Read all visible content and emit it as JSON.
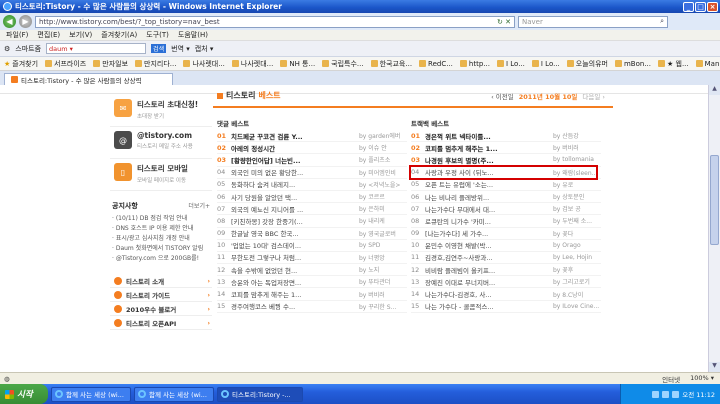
{
  "window": {
    "title": "티스토리:Tistory - 수 많은 사람들의 상상력 - Windows Internet Explorer",
    "min": "_",
    "max": "□",
    "close": "×"
  },
  "address": {
    "url": "http://www.tistory.com/best/?_top_tistory=nav_best",
    "search_placeholder": "Naver"
  },
  "menu": [
    "파일(F)",
    "편집(E)",
    "보기(V)",
    "즐겨찾기(A)",
    "도구(T)",
    "도움말(H)"
  ],
  "toolbar": {
    "brand": "스마트줌",
    "input_value": "daum ▾",
    "search_btn": "검색",
    "translate": "번역 ▾",
    "capture": "캡처 ▾"
  },
  "favorites": {
    "label": "즐겨찾기",
    "items": [
      "서프라이즈",
      "만자일보",
      "만지리다...",
      "나사렛대...",
      "나사렛대...",
      "NH 통...",
      "국립특수...",
      "한국교육...",
      "RedC...",
      "http...",
      "I Lo...",
      "I Lo...",
      "오늘의유머",
      "mBon...",
      "★ 웹...",
      "Mani..."
    ]
  },
  "tab": {
    "label": "티스토리:Tistory - 수 많은 사람들의 상상력"
  },
  "sidebar": {
    "items": [
      {
        "title": "티스토리 초대신청!",
        "sub": "초대장 받기"
      },
      {
        "title": "@tistory.com",
        "sub": "티스토리 메일 주소 사용"
      },
      {
        "title": "티스토리 모바일",
        "sub": "모바일 페이지로 이동"
      }
    ],
    "notice": {
      "title": "공지사항",
      "more": "더보기+",
      "items": [
        "(10/11) DB 점검 작업 안내",
        "DNS 호스트 IP 이용 제한 안내",
        "표시/광고 심사지침 개정 안내",
        "Daum 첫화면에서 TISTORY 알림",
        "@Tistory.com 으로 200GB를!"
      ]
    },
    "links": [
      "티스토리 소개",
      "티스토리 가이드",
      "2010우수 블로거",
      "티스토리 오픈API"
    ]
  },
  "main": {
    "title_prefix": "티스토리",
    "title_accent": "베스트",
    "prev": "‹ 이전일",
    "date": "2011년 10월 10일",
    "next": "다음일 ›",
    "left_col": {
      "heading": "댓글 베스트",
      "rows": [
        {
          "rank": "01",
          "title": "치드페균 꾸코견 검륜 Y...",
          "by": "by garden에버"
        },
        {
          "rank": "02",
          "title": "아레의 정성시간",
          "by": "by 이슈 안"
        },
        {
          "rank": "03",
          "title": "[황량한인어답] 너는빈...",
          "by": "by 플리츠소"
        },
        {
          "rank": "04",
          "title": "외국인 미의 없은 황당한...",
          "by": "by 미어엠인비"
        },
        {
          "rank": "05",
          "title": "동화하다 숨켜 내레지...",
          "by": "by <저녁노을>"
        },
        {
          "rank": "06",
          "title": "사기 당원을 알았던 택...",
          "by": "by 코르르"
        },
        {
          "rank": "07",
          "title": "외국의 예뇨신 지니어를 ...",
          "by": "by 은하미"
        },
        {
          "rank": "08",
          "title": "[키친하몽] 갓장 한중기(...",
          "by": "by 내리케"
        },
        {
          "rank": "09",
          "title": "한글날 영국 BBC 한국...",
          "by": "by 영국글로버"
        },
        {
          "rank": "10",
          "title": "'업없는 10대' 검스데이...",
          "by": "by SPD"
        },
        {
          "rank": "11",
          "title": "무한도전 그렇구나 처럼...",
          "by": "by 너평앙"
        },
        {
          "rank": "12",
          "title": "속을 수밖에 없었던 현...",
          "by": "by 노지"
        },
        {
          "rank": "13",
          "title": "승윤와 아는 독업저장면...",
          "by": "by 뚜타관더"
        },
        {
          "rank": "14",
          "title": "코피를 맘추게 해주는 1...",
          "by": "by 버비러"
        },
        {
          "rank": "15",
          "title": "경주여행코스 베꿩 수...",
          "by": "by 꾸리한 S..."
        }
      ]
    },
    "right_col": {
      "heading": "트랙백 베스트",
      "rows": [
        {
          "rank": "01",
          "title": "경은꺽 위트 넥타이를...",
          "by": "by 산듬강"
        },
        {
          "rank": "02",
          "title": "코피를 멈추게 해주는 1...",
          "by": "by 버비러"
        },
        {
          "rank": "03",
          "title": "나경원 후보의 별명(주...",
          "by": "by tollomania"
        },
        {
          "rank": "04",
          "title": "사랑과 우정 사이 (뒤노...",
          "by": "by 왜람(sleen..."
        },
        {
          "rank": "05",
          "title": "오픈 트는 유럽에 '소는...",
          "by": "by 유로"
        },
        {
          "rank": "06",
          "title": "나는 비나리 플레방위...",
          "by": "by 상토분인"
        },
        {
          "rank": "07",
          "title": "나는가수다 무대에서 대...",
          "by": "by 검보 공"
        },
        {
          "rank": "08",
          "title": "로큐탄의 니가수 '카미...",
          "by": "by 두번째 소..."
        },
        {
          "rank": "09",
          "title": "[나는가수다] 세 가수...",
          "by": "by 꽃다"
        },
        {
          "rank": "10",
          "title": "윤민수 이영현 채밭(박...",
          "by": "by Orago"
        },
        {
          "rank": "11",
          "title": "김경호,김연주~사랑과...",
          "by": "by Lee, Hojin"
        },
        {
          "rank": "12",
          "title": "비비람 플레빔이 올키프...",
          "by": "by 꽃후"
        },
        {
          "rank": "13",
          "title": "장예진 이대로 무너지버...",
          "by": "by 그리고로기"
        },
        {
          "rank": "14",
          "title": "나는가수다-김경호, 사...",
          "by": "by 8.C낭이"
        },
        {
          "rank": "15",
          "title": "나는 가수다 - 콜콤적스...",
          "by": "by ILove Cine..."
        }
      ]
    }
  },
  "status": {
    "zone": "인터넷",
    "zoom": "100% ▾"
  },
  "taskbar": {
    "start": "시작",
    "tasks": [
      "함께 사는 세상 (wi...",
      "함께 사는 세상 (wi...",
      "티스토리:Tistory -..."
    ],
    "clock": "오전 11:12"
  }
}
